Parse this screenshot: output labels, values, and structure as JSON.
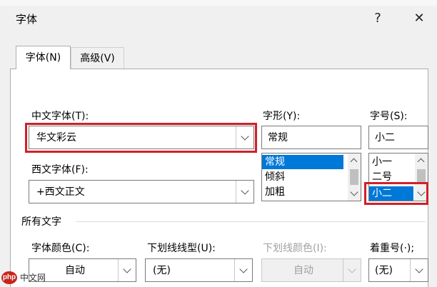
{
  "window": {
    "title": "字体",
    "help_symbol": "?",
    "close_symbol": "✕"
  },
  "tabs": [
    {
      "label": "字体(N)",
      "selected": true
    },
    {
      "label": "高级(V)",
      "selected": false
    }
  ],
  "font": {
    "chinese_font_label": "中文字体(T):",
    "chinese_font_value": "华文彩云",
    "western_font_label": "西文字体(F):",
    "western_font_value": "+西文正文",
    "style_label": "字形(Y):",
    "style_value": "常规",
    "style_options": [
      "常规",
      "倾斜",
      "加粗"
    ],
    "style_selected": "常规",
    "size_label": "字号(S):",
    "size_value": "小二",
    "size_options": [
      "小一",
      "二号",
      "小二"
    ],
    "size_selected": "小二"
  },
  "all_text": {
    "section_label": "所有文字",
    "font_color_label": "字体颜色(C):",
    "font_color_value": "自动",
    "underline_style_label": "下划线线型(U):",
    "underline_style_value": "(无)",
    "underline_color_label": "下划线颜色(I):",
    "underline_color_value": "自动",
    "emphasis_label": "着重号(·);",
    "emphasis_value": "(无)"
  },
  "watermark": {
    "badge": "php",
    "text": "中文网"
  },
  "colors": {
    "highlight_red": "#d0202a",
    "selection_blue": "#0078d7",
    "panel_bg": "#ffffff",
    "dialog_bg": "#f0f0f0"
  }
}
